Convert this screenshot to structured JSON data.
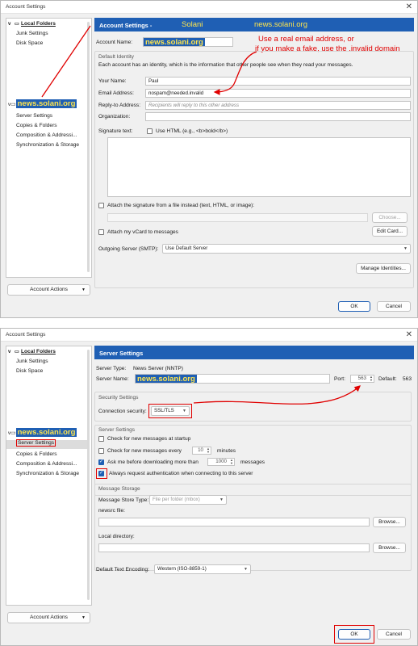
{
  "window1": {
    "title": "Account Settings",
    "tree": {
      "local_folders": "Local Folders",
      "junk_settings": "Junk Settings",
      "disk_space": "Disk Space",
      "account": "news.solani.org",
      "server_settings": "Server Settings",
      "copies_folders": "Copies & Folders",
      "composition": "Composition & Addressi...",
      "sync_storage": "Synchronization & Storage"
    },
    "account_actions": "Account Actions",
    "header_title": "Account Settings -",
    "header_name": "Solani",
    "header_host": "news.solani.org",
    "account_name_label": "Account Name:",
    "account_name_value": "news.solani.org",
    "default_identity_title": "Default Identity",
    "identity_desc": "Each account has an identity, which is the information that other people see when they read your messages.",
    "your_name_label": "Your Name:",
    "your_name_value": "Paul",
    "email_label": "Email Address:",
    "email_value": "nospam@needed.invalid",
    "reply_to_label": "Reply-to Address:",
    "reply_to_placeholder": "Recipients will reply to this other address",
    "organization_label": "Organization:",
    "signature_label": "Signature text:",
    "use_html_label": "Use HTML (e.g., <b>bold</b>)",
    "attach_sig_label": "Attach the signature from a file instead (text, HTML, or image):",
    "choose_button": "Choose...",
    "attach_vcard_label": "Attach my vCard to messages",
    "edit_card_button": "Edit Card...",
    "outgoing_label": "Outgoing Server (SMTP):",
    "outgoing_value": "Use Default Server",
    "manage_identities": "Manage Identities...",
    "ok": "OK",
    "cancel": "Cancel",
    "annotation_line1": "Use a real email address, or",
    "annotation_line2": "if you make a fake, use the .invalid domain"
  },
  "window2": {
    "title": "Account Settings",
    "tree": {
      "local_folders": "Local Folders",
      "junk_settings": "Junk Settings",
      "disk_space": "Disk Space",
      "account": "news.solani.org",
      "server_settings": "Server Settings",
      "copies_folders": "Copies & Folders",
      "composition": "Composition & Addressi...",
      "sync_storage": "Synchronization & Storage"
    },
    "account_actions": "Account Actions",
    "header_title": "Server Settings",
    "server_type_label": "Server Type:",
    "server_type_value": "News Server (NNTP)",
    "server_name_label": "Server Name:",
    "server_name_value": "news.solani.org",
    "port_label": "Port:",
    "port_value": "563",
    "default_label": "Default:",
    "default_value": "563",
    "security_title": "Security Settings",
    "connection_security_label": "Connection security:",
    "connection_security_value": "SSL/TLS",
    "server_settings_title": "Server Settings",
    "check_startup_label": "Check for new messages at startup",
    "check_every_label": "Check for new messages every",
    "check_every_value": "10",
    "minutes_label": "minutes",
    "ask_me_label": "Ask me before downloading more than",
    "ask_me_value": "1000",
    "messages_label": "messages",
    "always_auth_label": "Always request authentication when connecting to this server",
    "message_storage_title": "Message Storage",
    "store_type_label": "Message Store Type:",
    "store_type_value": "File per folder (mbox)",
    "newsrc_label": "newsrc file:",
    "browse_button": "Browse...",
    "local_dir_label": "Local directory:",
    "default_encoding_label": "Default Text Encoding:",
    "default_encoding_value": "Western (ISO-8859-1)",
    "ok": "OK",
    "cancel": "Cancel"
  },
  "colors": {
    "accent": "#1f5fb4",
    "highlight_text": "#ffe54c",
    "annotation": "#e00000"
  }
}
